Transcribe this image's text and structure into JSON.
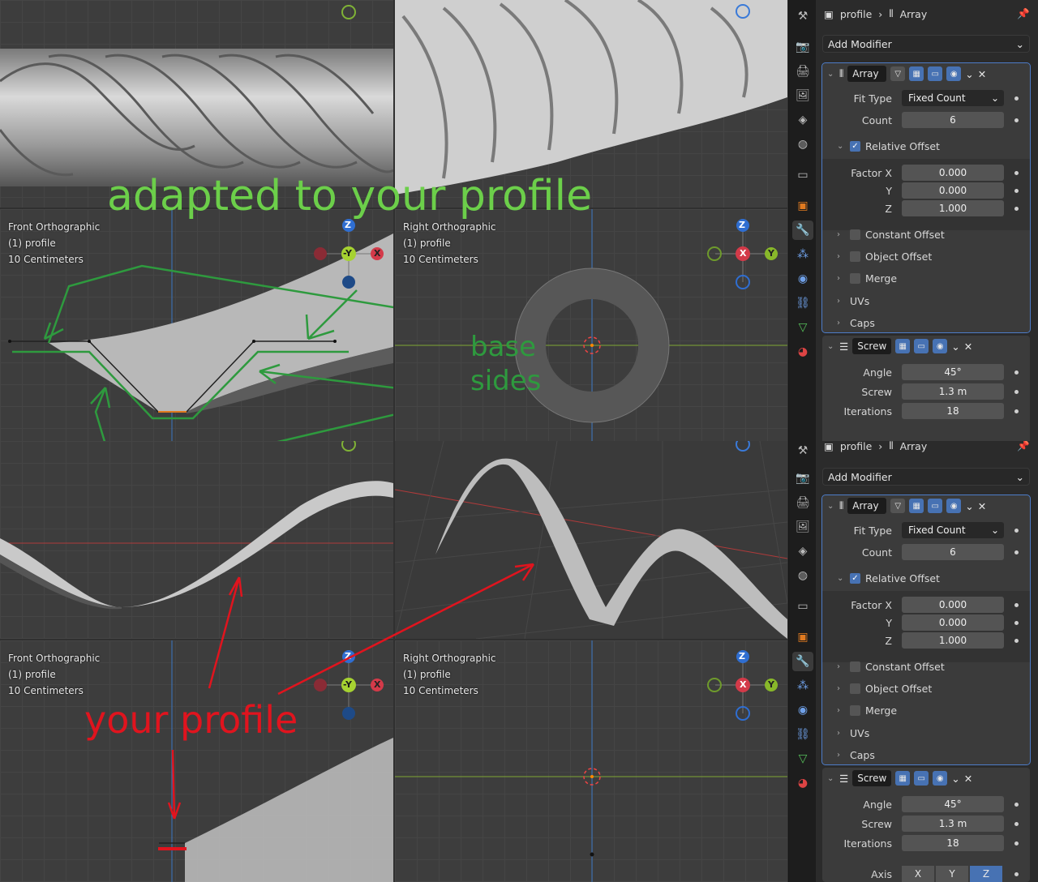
{
  "overlay_text": {
    "adapted": "adapted to your profile",
    "base": "base",
    "sides": "sides",
    "your_profile": "your profile"
  },
  "viewports": {
    "front_title": "Front Orthographic",
    "right_title": "Right Orthographic",
    "object": "(1) profile",
    "scale": "10 Centimeters"
  },
  "gizmo": {
    "z": "Z",
    "x": "X",
    "y": "Y",
    "neg_y": "-Y"
  },
  "properties": {
    "breadcrumb_object": "profile",
    "breadcrumb_modifier": "Array",
    "add_modifier": "Add Modifier",
    "array": {
      "name": "Array",
      "fit_type_label": "Fit Type",
      "fit_type_value": "Fixed Count",
      "count_label": "Count",
      "count_value": "6",
      "relative_offset": "Relative Offset",
      "factor_x_label": "Factor X",
      "factor_x": "0.000",
      "y_label": "Y",
      "factor_y": "0.000",
      "z_label": "Z",
      "factor_z": "1.000",
      "constant_offset": "Constant Offset",
      "object_offset": "Object Offset",
      "merge": "Merge",
      "uvs": "UVs",
      "caps": "Caps"
    },
    "screw": {
      "name": "Screw",
      "angle_label": "Angle",
      "angle_value": "45°",
      "screw_label": "Screw",
      "screw_value": "1.3 m",
      "iterations_label": "Iterations",
      "iterations_value": "18",
      "axis_label": "Axis",
      "axis_x": "X",
      "axis_y": "Y",
      "axis_z": "Z"
    }
  },
  "colors": {
    "annotation_green": "#2e9a3e",
    "title_green": "#6ccf4a",
    "annotation_red": "#e0141e",
    "accent_blue": "#4772b3"
  }
}
